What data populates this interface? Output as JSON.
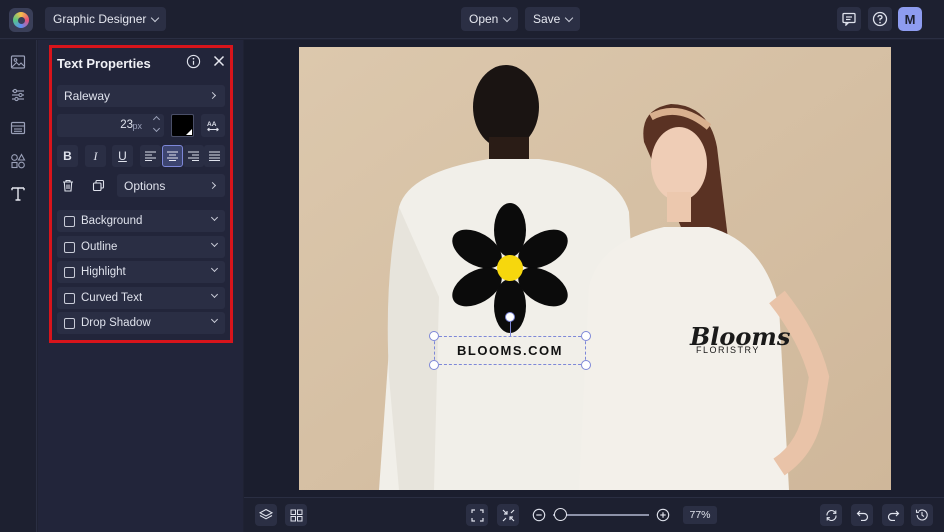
{
  "app": {
    "mode_label": "Graphic Designer",
    "open_label": "Open",
    "save_label": "Save",
    "avatar_initial": "M"
  },
  "panel": {
    "title": "Text Properties",
    "font_name": "Raleway",
    "font_size": "23",
    "font_unit": "px",
    "text_color": "#000000",
    "bold_label": "B",
    "italic_label": "I",
    "underline_label": "U",
    "options_label": "Options",
    "sections": [
      {
        "label": "Background",
        "checked": false
      },
      {
        "label": "Outline",
        "checked": false
      },
      {
        "label": "Highlight",
        "checked": false
      },
      {
        "label": "Curved Text",
        "checked": false
      },
      {
        "label": "Drop Shadow",
        "checked": false
      }
    ]
  },
  "canvas": {
    "selected_text": "BLOOMS.COM",
    "shirt_logo_script": "Blooms",
    "shirt_logo_sub": "FLORISTRY"
  },
  "zoom": {
    "label": "77%",
    "level": 0.77
  },
  "colors": {
    "accent_red": "#d8141b",
    "avatar": "#8e9cf0",
    "active_align": "#3d4570"
  }
}
